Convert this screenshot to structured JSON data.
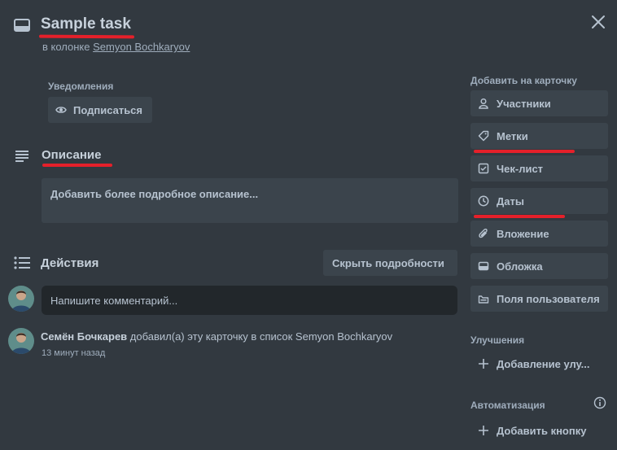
{
  "card": {
    "title": "Sample task",
    "in_column_prefix": "в колонке",
    "column_name": "Semyon Bochkaryov"
  },
  "notifications": {
    "label": "Уведомления",
    "subscribe_label": "Подписаться"
  },
  "description": {
    "title": "Описание",
    "placeholder": "Добавить более подробное описание..."
  },
  "activity": {
    "title": "Действия",
    "hide_details_label": "Скрыть подробности",
    "comment_placeholder": "Напишите комментарий...",
    "entries": [
      {
        "author": "Семён Бочкарев",
        "text": "добавил(а) эту карточку в список Semyon Bochkaryov",
        "time": "13 минут назад"
      }
    ]
  },
  "sidebar": {
    "add_to_card_label": "Добавить на карточку",
    "buttons": [
      {
        "label": "Участники",
        "icon": "person-icon"
      },
      {
        "label": "Метки",
        "icon": "tag-icon"
      },
      {
        "label": "Чек-лист",
        "icon": "checkbox-icon"
      },
      {
        "label": "Даты",
        "icon": "clock-icon"
      },
      {
        "label": "Вложение",
        "icon": "paperclip-icon"
      },
      {
        "label": "Обложка",
        "icon": "cover-icon"
      },
      {
        "label": "Поля пользователя",
        "icon": "custom-fields-icon"
      }
    ],
    "improvements_label": "Улучшения",
    "add_improvement_label": "Добавление улу...",
    "automation_label": "Автоматизация",
    "add_button_label": "Добавить кнопку"
  },
  "colors": {
    "background": "#323940",
    "button": "#3b444c",
    "annotation": "#e5202a"
  }
}
